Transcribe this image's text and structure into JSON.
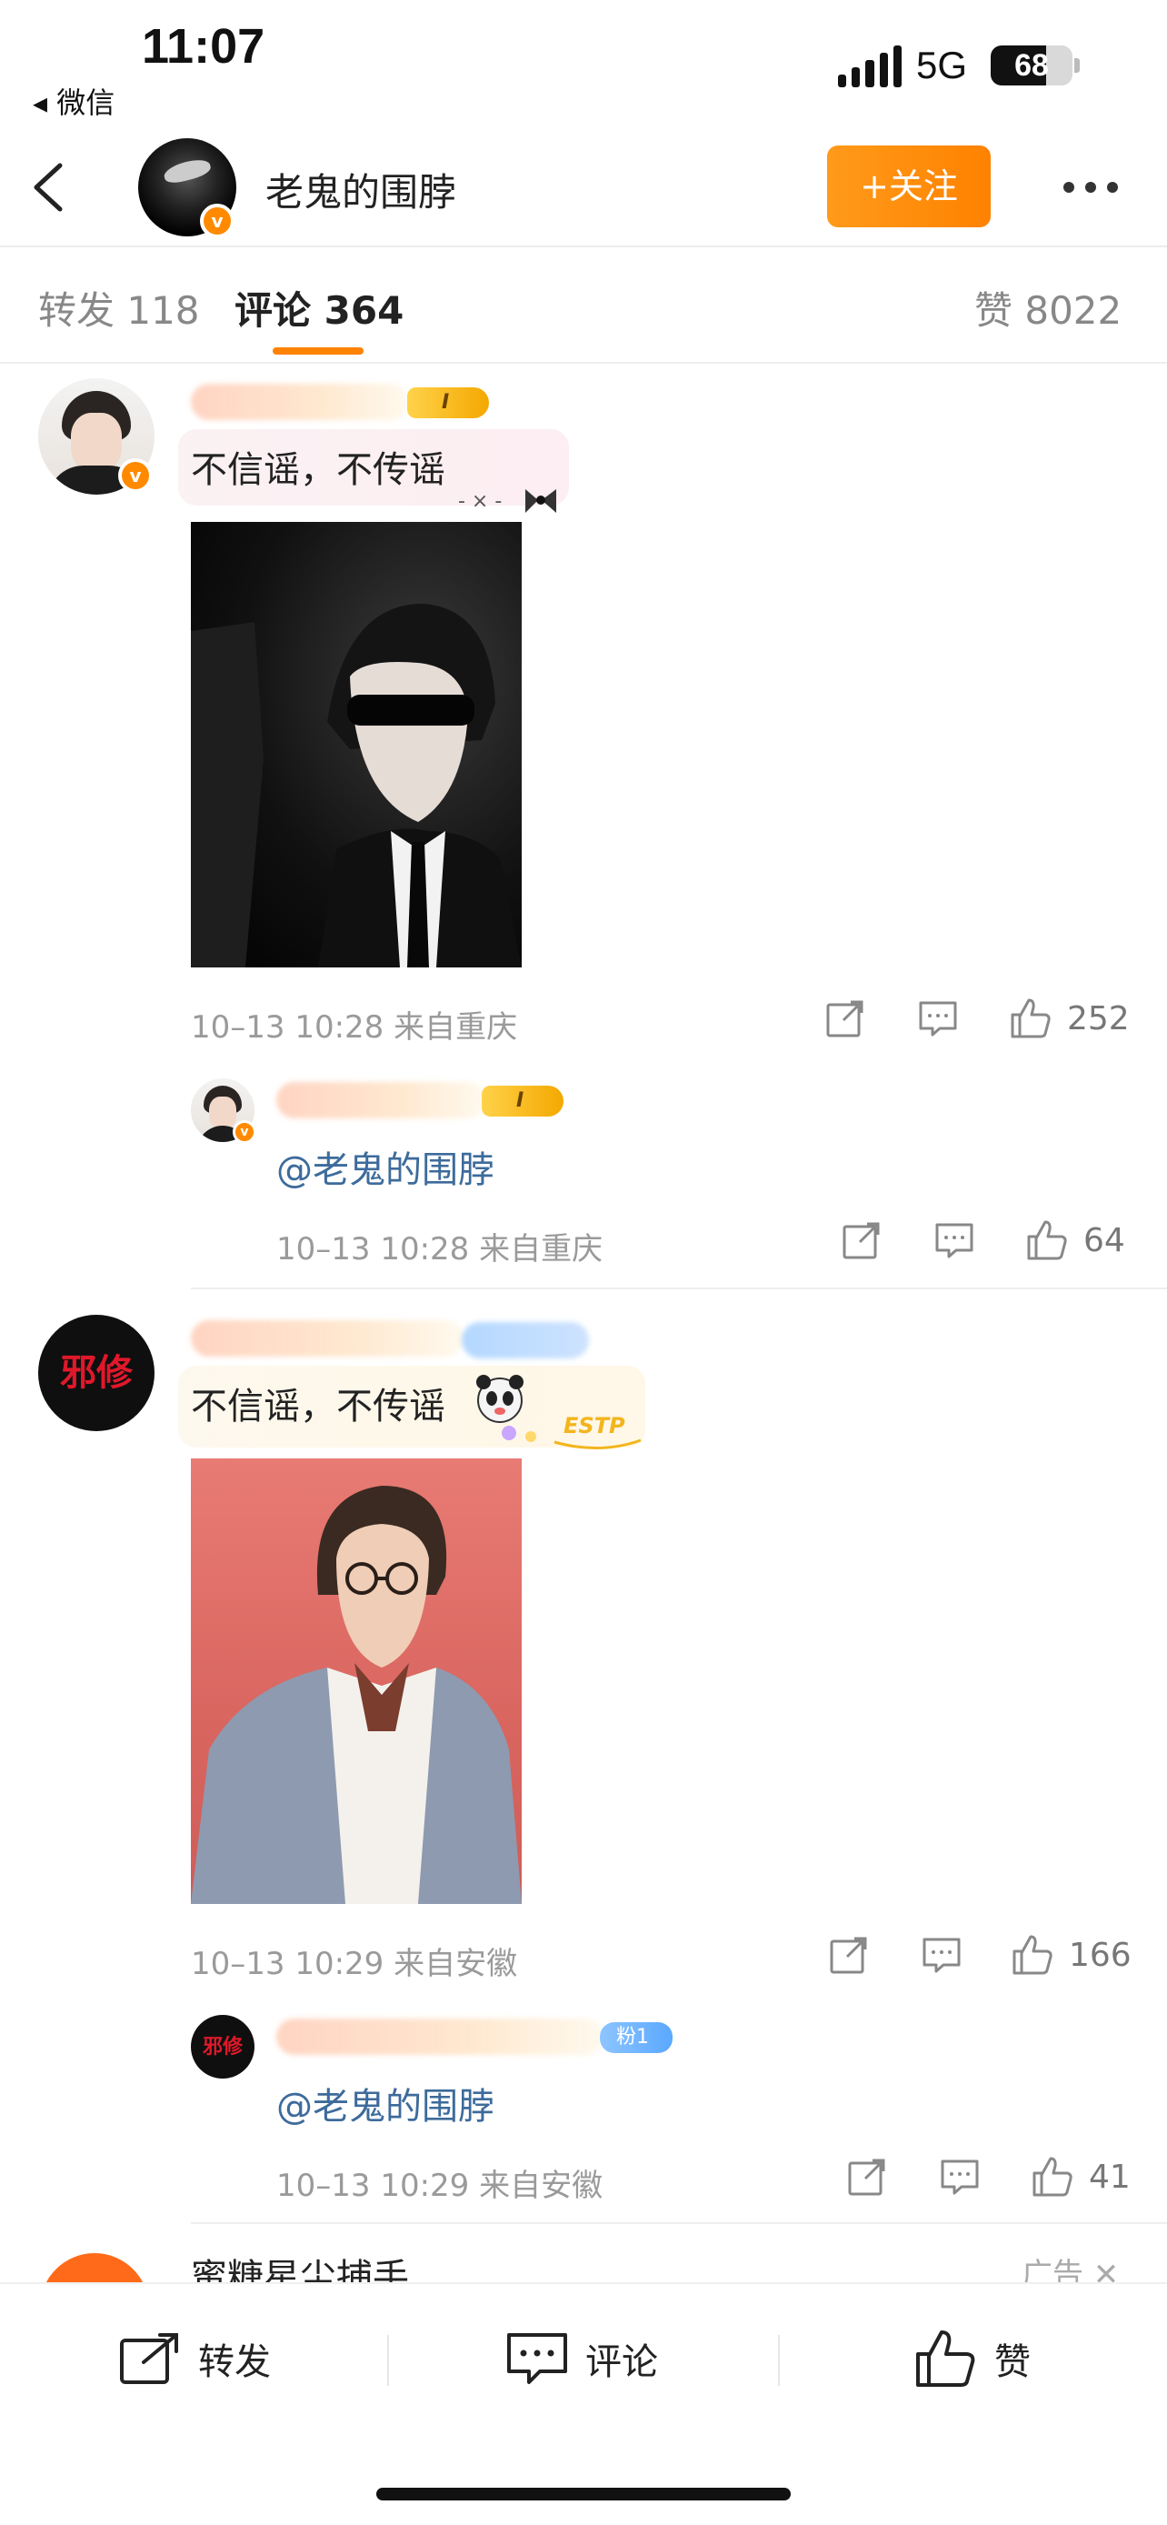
{
  "status_bar": {
    "time": "11:07",
    "back_app": "◂ 微信",
    "network": "5G",
    "battery": "68",
    "battery_level": 0.68
  },
  "header": {
    "account_name": "老鬼的围脖",
    "follow_label": "+关注"
  },
  "tabs": {
    "repost": "转发 118",
    "comments": "评论 364",
    "likes": "赞 8022"
  },
  "comments": [
    {
      "text": "不信谣，不传谣",
      "avatar_text": "",
      "badge": "I",
      "meta": "10–13 10:28  来自重庆",
      "likes": "252",
      "reply": {
        "badge": "I",
        "mention": "@老鬼的围脖",
        "meta": "10–13 10:28  来自重庆",
        "likes": "64"
      }
    },
    {
      "text": "不信谣，不传谣",
      "avatar_text": "邪修",
      "sticker_text": "ESTP",
      "meta": "10–13 10:29  来自安徽",
      "likes": "166",
      "reply": {
        "avatar_text": "邪修",
        "badge": "粉1",
        "mention": "@老鬼的围脖",
        "meta": "10–13 10:29  来自安徽",
        "likes": "41"
      }
    }
  ],
  "ad": {
    "name": "蜜糖星尘捕手",
    "tag": "广告 ✕"
  },
  "bottom_bar": {
    "repost": "转发",
    "comment": "评论",
    "like": "赞"
  },
  "colors": {
    "accent": "#ff8200",
    "mention": "#3d6b9b",
    "meta": "#9a9a9a"
  }
}
